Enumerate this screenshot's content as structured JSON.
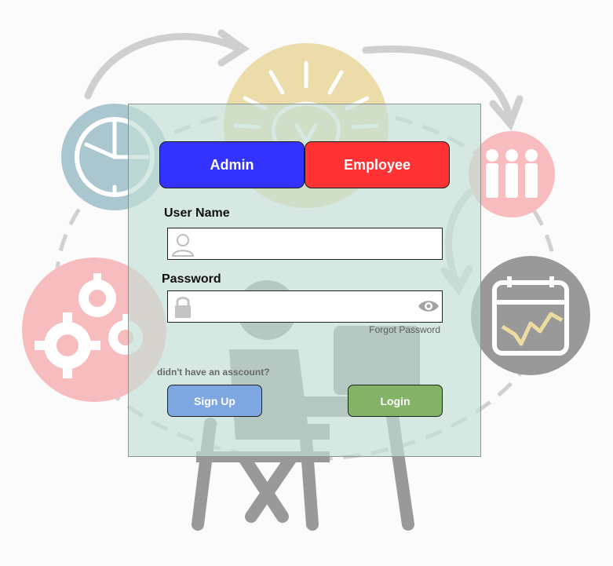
{
  "roles": {
    "admin_label": "Admin",
    "employee_label": "Employee"
  },
  "form": {
    "username_label": "User Name",
    "username_value": "",
    "password_label": "Password",
    "password_value": "",
    "forgot_password": "Forgot Password",
    "signup_hint": "didn't have an asscount?",
    "signup_label": "Sign Up",
    "login_label": "Login"
  },
  "icons": {
    "username": "user-icon",
    "password": "lock-icon",
    "show_password": "eye-icon"
  },
  "colors": {
    "admin": "#3333ff",
    "employee": "#ff3333",
    "signup": "#7ea6e0",
    "login": "#82b366"
  }
}
